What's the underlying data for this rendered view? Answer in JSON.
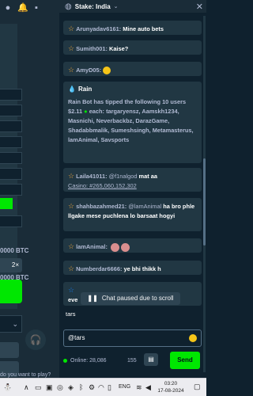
{
  "chat": {
    "room_title": "Stake: India",
    "messages": [
      {
        "user": "Arunyadav6161:",
        "text": "Mine auto bets"
      },
      {
        "user": "Sumith001:",
        "text": "Kaise?"
      },
      {
        "user": "AmyD05:",
        "text": ""
      },
      {
        "user": "Laila41011:",
        "mention": "@f1nalgod",
        "text": "mat aa",
        "link": "Casino: #265,060,152,302"
      },
      {
        "user": "shahbazahmed21:",
        "mention": "@lamAnimal",
        "text": "ha bro phle llgake mese puchlena lo barsaat hogyi"
      },
      {
        "user": "lamAnimal:",
        "text": ""
      },
      {
        "user": "Numberdar6666:",
        "text": "ye bhi thikk h"
      },
      {
        "user": "",
        "text": "eve"
      }
    ],
    "rain": {
      "title": "Rain",
      "body_prefix": "Rain Bot has tipped the following 10 users $2.11",
      "body_each": "each:",
      "recipients": "targaryensz, Aamskh1234, Masnichi, Neverbackbz, DarazGame, Shadabbmalik, Sumeshsingh, Metamasterus, lamAnimal, Savsports"
    },
    "paused_label": "Chat paused due to scroll",
    "suggest": "tars",
    "input_value": "@tars",
    "online_label": "Online: 28,086",
    "count": "155",
    "send_label": "Send"
  },
  "game": {
    "btc_label_1": "0000 BTC",
    "multiplier_label": "2×",
    "btc_label_2": "0000 BTC",
    "prompt_text": "do you want to play?"
  },
  "taskbar": {
    "lang": "ENG",
    "time": "03:20",
    "date": "17-08-2024"
  },
  "colors": {
    "background": "#0f212e",
    "panel": "#213743",
    "accent_green": "#00e701",
    "muted_text": "#b1bad3"
  }
}
